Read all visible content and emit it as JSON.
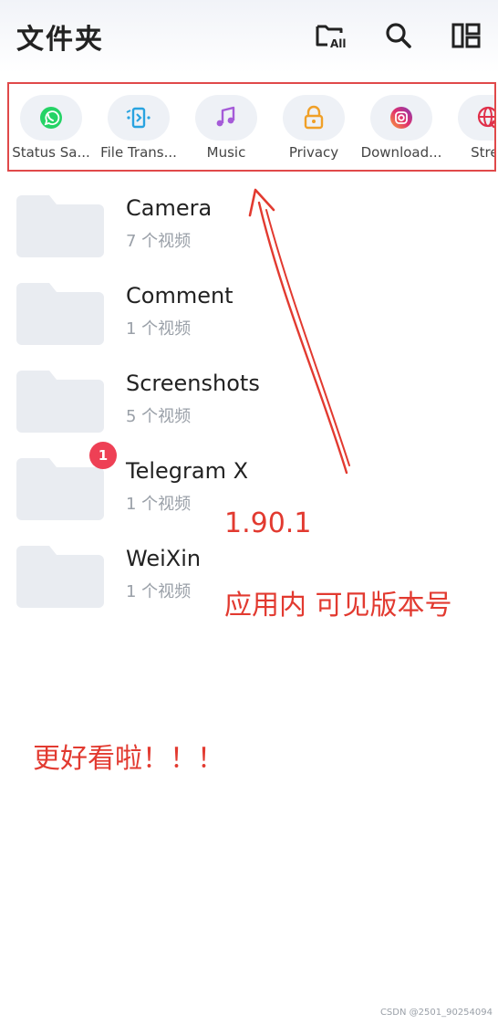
{
  "header": {
    "title": "文件夹",
    "actions": [
      {
        "name": "all-folders-icon",
        "text": "All"
      },
      {
        "name": "search-icon"
      },
      {
        "name": "layout-toggle-icon"
      }
    ]
  },
  "shortcuts": [
    {
      "label": "Status Sa...",
      "icon": "whatsapp-icon",
      "color": "#25d366"
    },
    {
      "label": "File Trans...",
      "icon": "file-transfer-icon",
      "color": "#29a3e0"
    },
    {
      "label": "Music",
      "icon": "music-icon",
      "color": "#a55bd8"
    },
    {
      "label": "Privacy",
      "icon": "lock-icon",
      "color": "#f0a028"
    },
    {
      "label": "Download...",
      "icon": "instagram-icon",
      "color": "#e1306c"
    },
    {
      "label": "Strea",
      "icon": "globe-icon",
      "color": "#e0304a"
    }
  ],
  "folders": [
    {
      "name": "Camera",
      "count": "7 个视频"
    },
    {
      "name": "Comment",
      "count": "1 个视频"
    },
    {
      "name": "Screenshots",
      "count": "5 个视频"
    },
    {
      "name": "Telegram X",
      "count": "1 个视频",
      "badge": "1"
    },
    {
      "name": "WeiXin",
      "count": "1 个视频"
    }
  ],
  "annotations": {
    "version": "1.90.1",
    "note": "应用内 可见版本号",
    "praise": "更好看啦！！！"
  },
  "watermark": "CSDN @2501_90254094",
  "colors": {
    "annotation": "#e23a30",
    "folder": "#e9ecf1",
    "badge": "#ee4055"
  }
}
